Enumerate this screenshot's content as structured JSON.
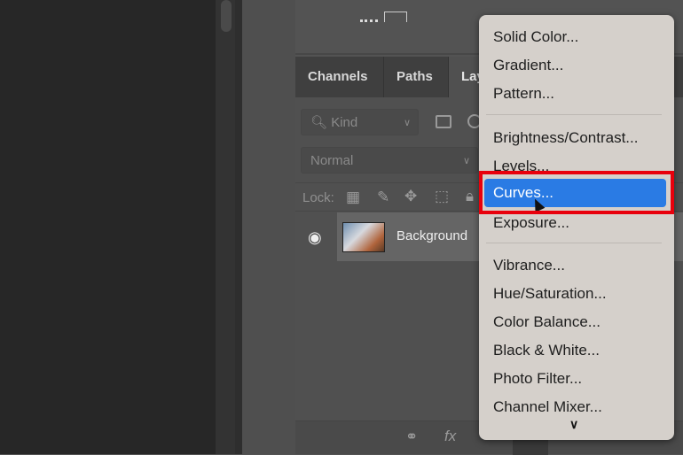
{
  "tabs": [
    "Channels",
    "Paths",
    "Layers"
  ],
  "filter": {
    "placeholder": "Kind",
    "search_icon": "search-icon"
  },
  "blend_mode": "Normal",
  "lock_label": "Lock:",
  "layer": {
    "name": "Background"
  },
  "menu": {
    "groups": [
      [
        "Solid Color...",
        "Gradient...",
        "Pattern..."
      ],
      [
        "Brightness/Contrast...",
        "Levels...",
        "Curves...",
        "Exposure..."
      ],
      [
        "Vibrance...",
        "Hue/Saturation...",
        "Color Balance...",
        "Black & White...",
        "Photo Filter...",
        "Channel Mixer..."
      ]
    ],
    "selected": "Curves..."
  },
  "bottom_icons": [
    "link-icon",
    "fx-icon"
  ],
  "bottom_fx": "fx",
  "colors": {
    "highlight": "#2a7be4",
    "annotation": "#e8000c",
    "menu_bg": "#d5d0cb"
  }
}
